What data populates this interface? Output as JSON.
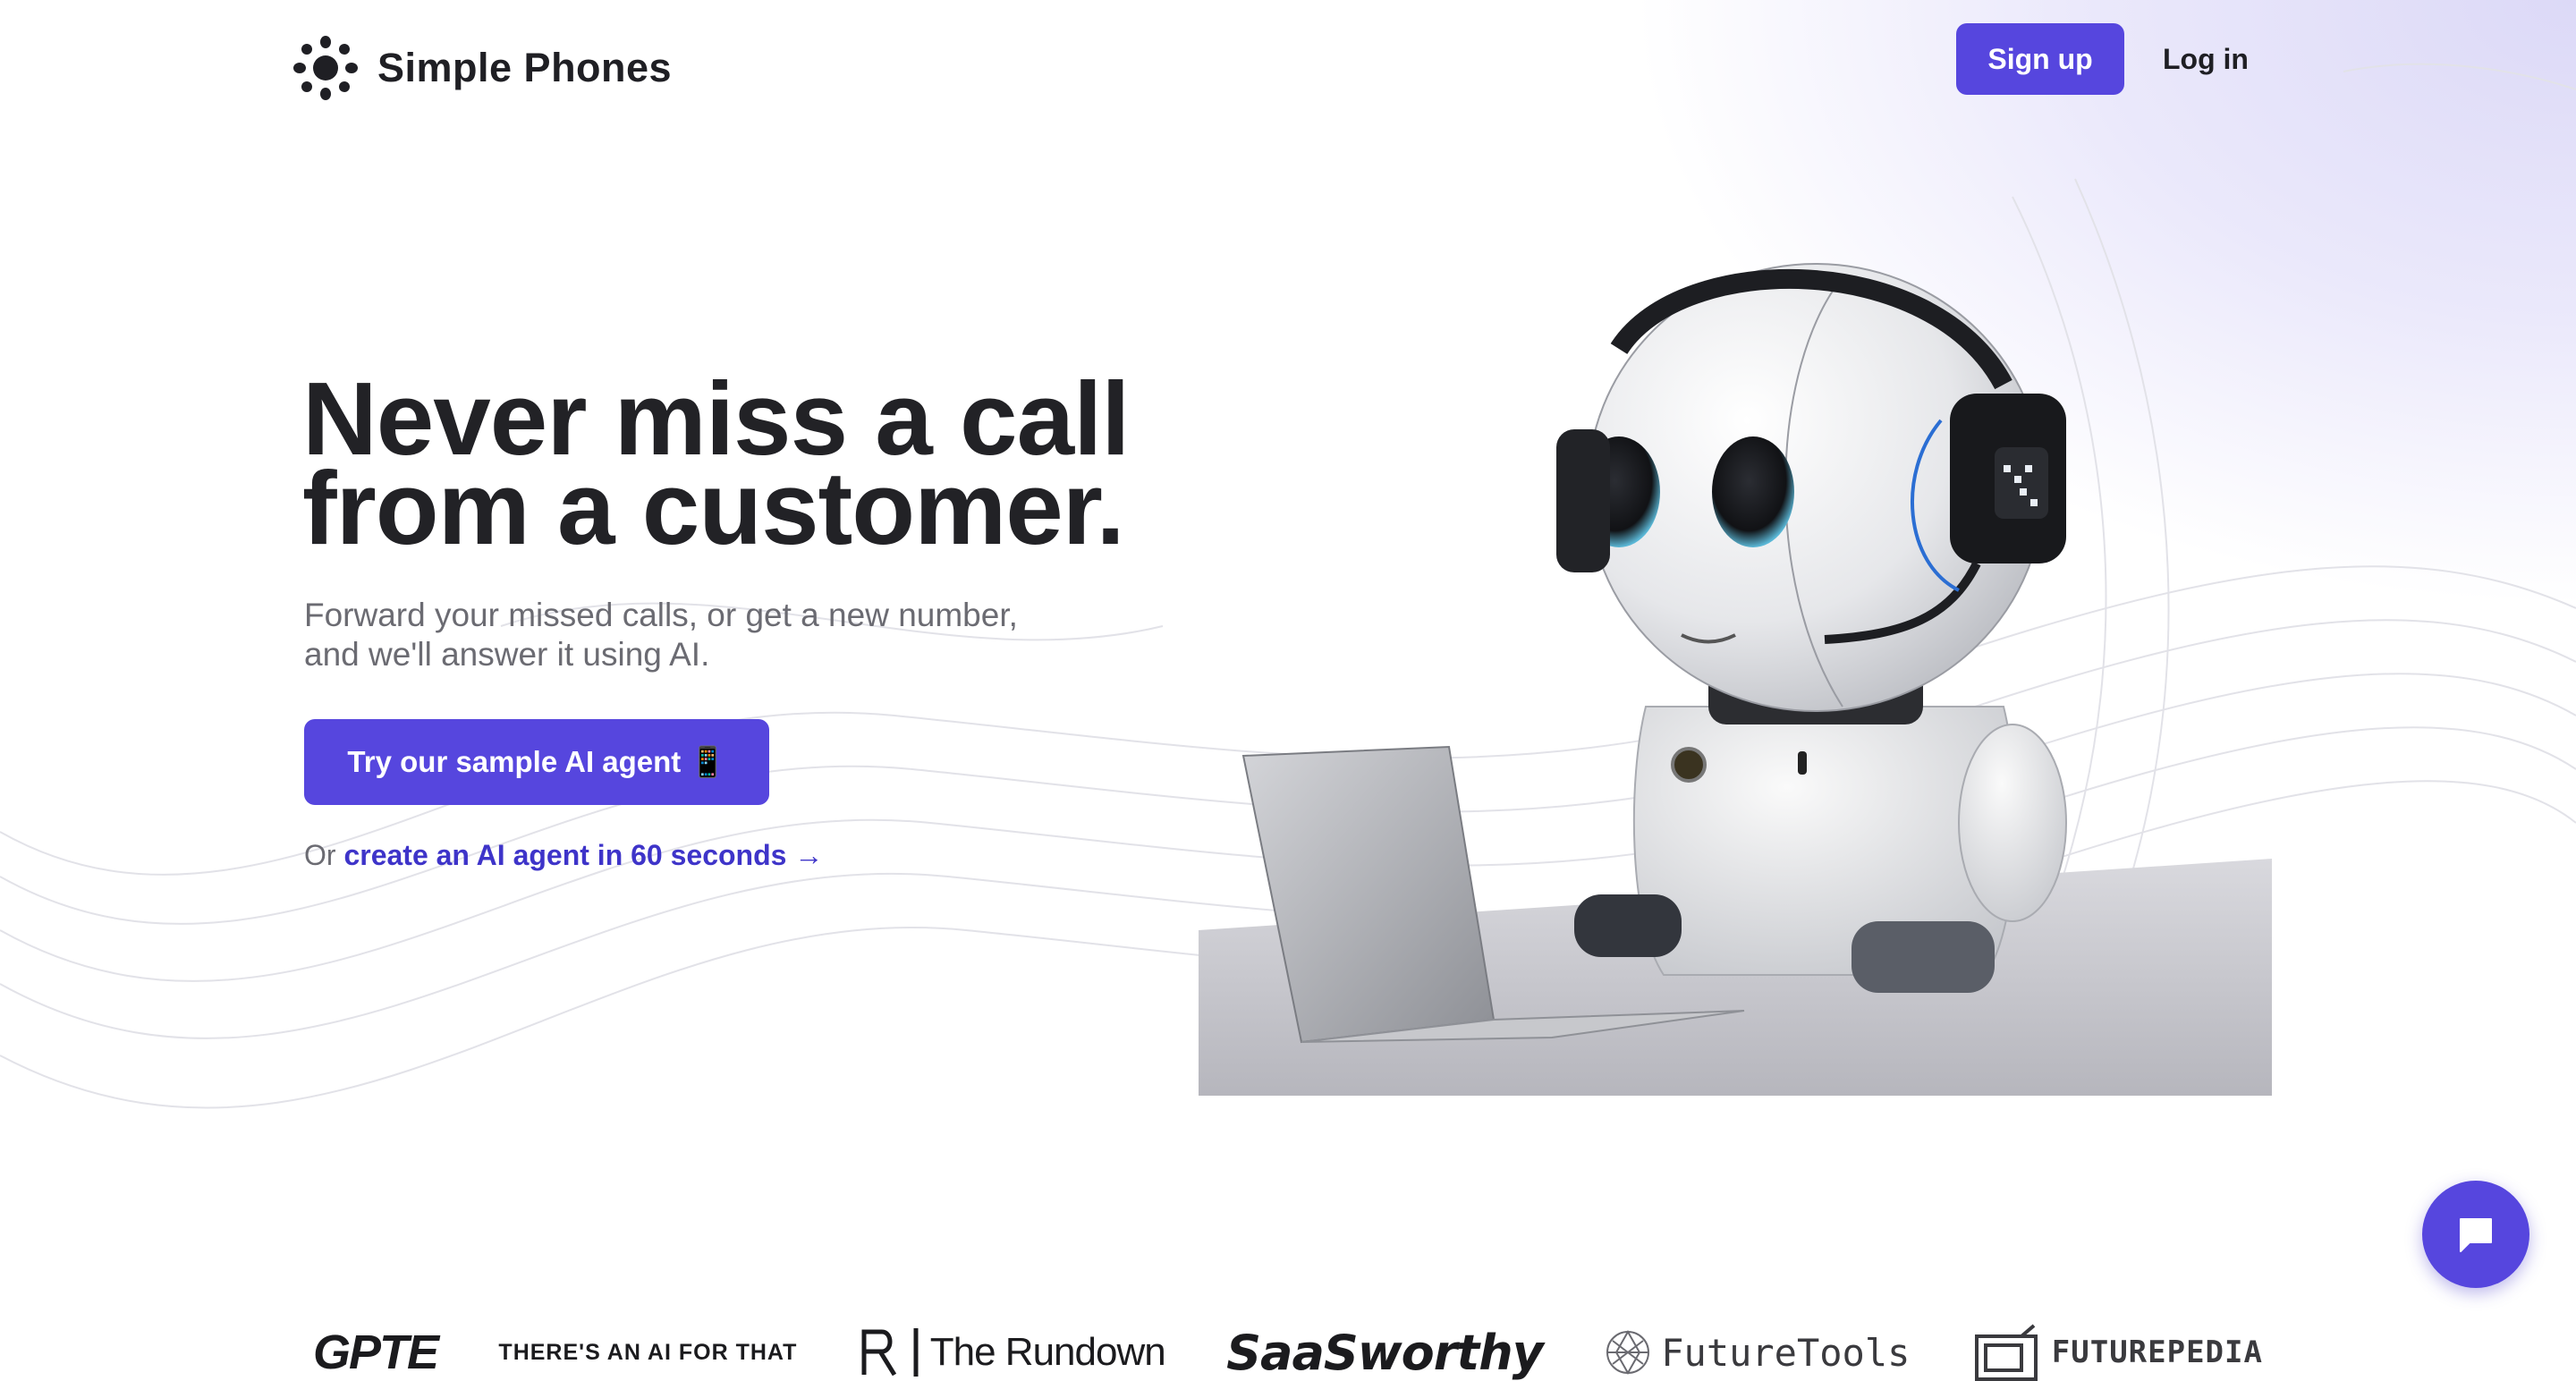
{
  "header": {
    "brand": "Simple Phones",
    "signup_label": "Sign up",
    "login_label": "Log in"
  },
  "hero": {
    "headline_line1": "Never miss a call",
    "headline_line2": "from a customer.",
    "subtext_line1": "Forward your missed calls, or get a new number,",
    "subtext_line2": "and we'll answer it using AI.",
    "cta_label": "Try our sample AI agent 📱",
    "secondary_prefix": "Or",
    "secondary_link": "create an AI agent in 60 seconds →"
  },
  "logos": {
    "gpte": "GPTE",
    "aift": "THERE'S AN AI FOR THAT",
    "rundown": "The Rundown",
    "saasworthy": "SaaSworthy",
    "futuretools": "FutureTools",
    "futurepedia": "FUTUREPEDIA"
  },
  "colors": {
    "accent": "#5646de",
    "link": "#3e34c9",
    "text": "#222226",
    "muted": "#6b6b72"
  },
  "icons": {
    "brand": "sun-burst-icon",
    "chat": "chat-bubble-icon",
    "illustration": "robot-with-headset-and-laptop"
  }
}
